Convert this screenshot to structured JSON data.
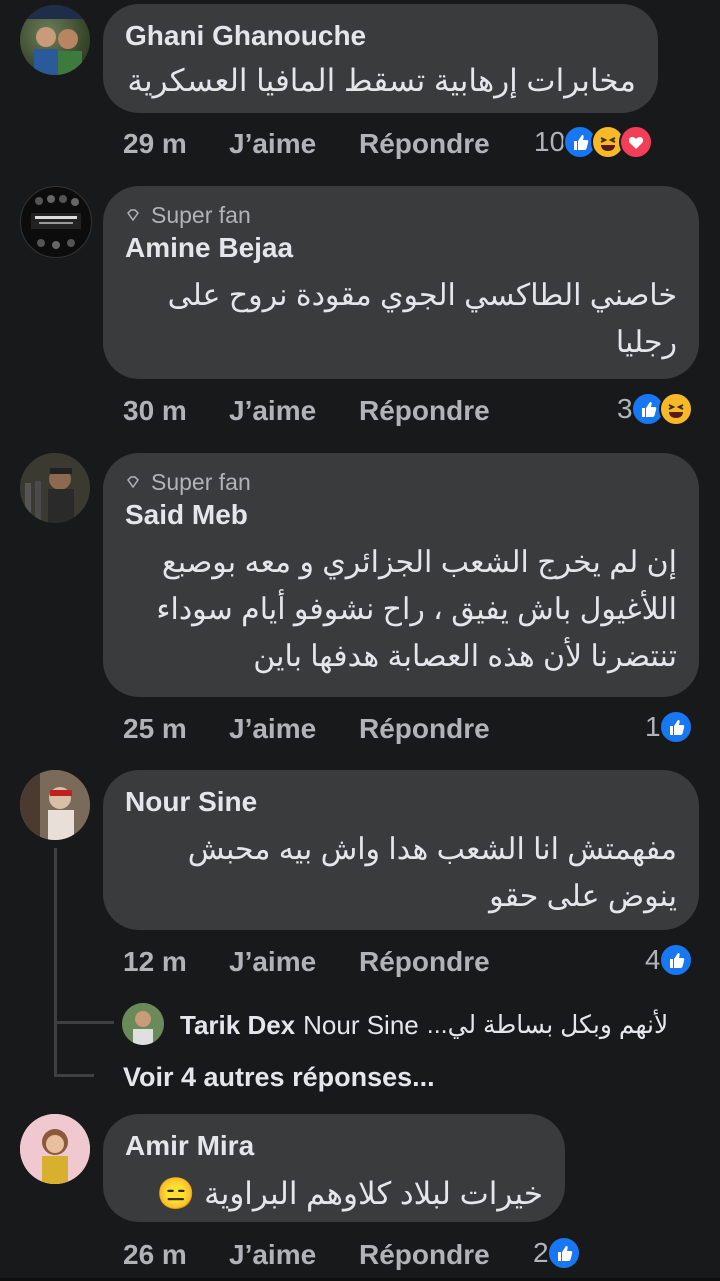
{
  "comments": [
    {
      "author": "Ghani Ghanouche",
      "badge": "",
      "text": "مخابرات إرهابية تسقط المافيا العسكرية",
      "time": "29 m",
      "like_label": "J’aime",
      "reply_label": "Répondre",
      "reaction_count": "10",
      "reactions": [
        "like-icon",
        "haha-icon",
        "love-icon"
      ]
    },
    {
      "author": "Amine Bejaa",
      "badge": "Super fan",
      "text": "خاصني الطاكسي الجوي مقودة نروح على رجليا",
      "time": "30 m",
      "like_label": "J’aime",
      "reply_label": "Répondre",
      "reaction_count": "3",
      "reactions": [
        "like-icon",
        "haha-icon"
      ]
    },
    {
      "author": "Said Meb",
      "badge": "Super fan",
      "text": "إن لم يخرج الشعب الجزائري و معه بوصبع اللأغيول باش يفيق ، راح نشوفو أيام سوداء تنتضرنا لأن هذه العصابة هدفها باين",
      "time": "25 m",
      "like_label": "J’aime",
      "reply_label": "Répondre",
      "reaction_count": "1",
      "reactions": [
        "like-icon"
      ]
    },
    {
      "author": "Nour Sine",
      "badge": "",
      "text": "مفهمتش انا الشعب هدا واش بيه محبش ينوض على حقو",
      "time": "12 m",
      "like_label": "J’aime",
      "reply_label": "Répondre",
      "reaction_count": "4",
      "reactions": [
        "like-icon"
      ]
    },
    {
      "author": "Amir Mira",
      "badge": "",
      "text": "خيرات لبلاد كلاوهم البراوية 😑",
      "time": "26 m",
      "like_label": "J’aime",
      "reply_label": "Répondre",
      "reaction_count": "2",
      "reactions": [
        "like-icon"
      ]
    }
  ],
  "reply_preview": {
    "author": "Tarik Dex",
    "mention": "Nour Sine",
    "text": "لأنهم وبكل بساطة لي..."
  },
  "more_replies": "Voir 4 autres réponses...",
  "colors": {
    "background": "#18191a",
    "bubble": "#3a3b3c",
    "secondary_text": "#b0b3b8",
    "like_blue": "#1877f2",
    "haha_yellow": "#f7b928",
    "love_red": "#f33e58"
  }
}
